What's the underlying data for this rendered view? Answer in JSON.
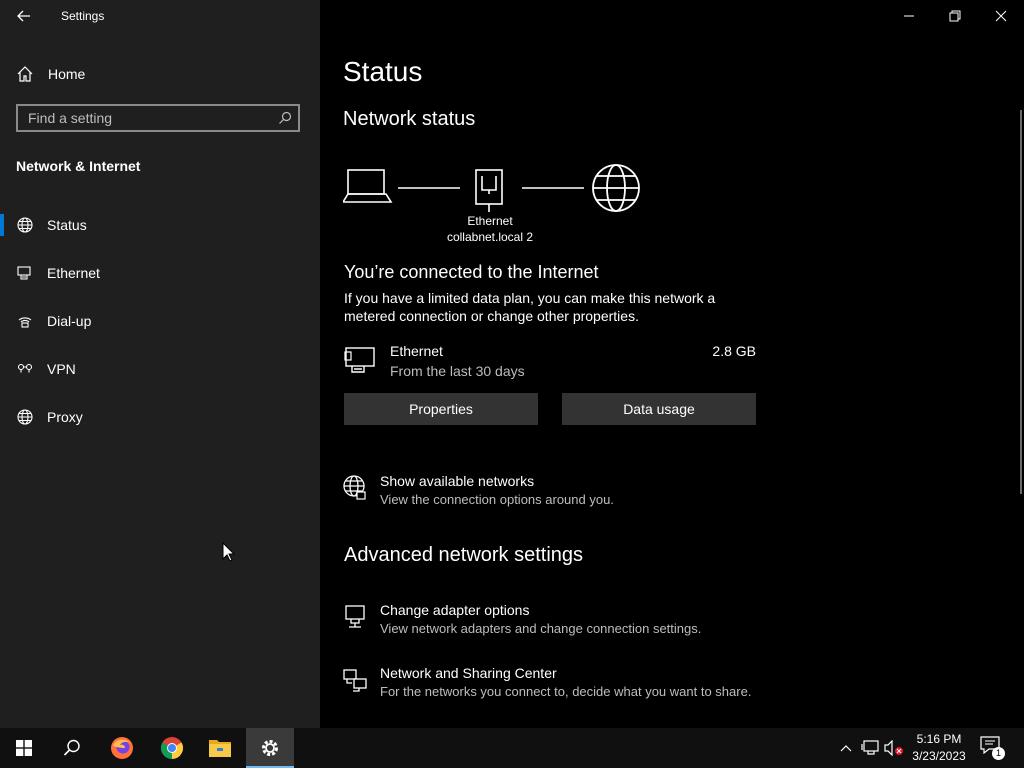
{
  "window": {
    "title": "Settings",
    "controls": {
      "minimize": "minimize",
      "restore": "restore",
      "close": "close"
    }
  },
  "sidebar": {
    "home_label": "Home",
    "search": {
      "placeholder": "Find a setting",
      "value": ""
    },
    "section_title": "Network & Internet",
    "items": [
      {
        "label": "Status",
        "icon": "globe-icon",
        "active": true
      },
      {
        "label": "Ethernet",
        "icon": "ethernet-icon",
        "active": false
      },
      {
        "label": "Dial-up",
        "icon": "dialup-icon",
        "active": false
      },
      {
        "label": "VPN",
        "icon": "vpn-icon",
        "active": false
      },
      {
        "label": "Proxy",
        "icon": "globe-icon",
        "active": false
      }
    ]
  },
  "main": {
    "page_title": "Status",
    "network_status_title": "Network status",
    "diagram": {
      "adapter_name": "Ethernet",
      "network_name": "collabnet.local 2"
    },
    "connected_title": "You’re connected to the Internet",
    "connected_desc": "If you have a limited data plan, you can make this network a metered connection or change other properties.",
    "connection": {
      "name": "Ethernet",
      "subtitle": "From the last 30 days",
      "usage": "2.8 GB"
    },
    "buttons": {
      "properties": "Properties",
      "data_usage": "Data usage"
    },
    "show_networks": {
      "title": "Show available networks",
      "subtitle": "View the connection options around you."
    },
    "advanced_title": "Advanced network settings",
    "advanced_links": [
      {
        "title": "Change adapter options",
        "subtitle": "View network adapters and change connection settings."
      },
      {
        "title": "Network and Sharing Center",
        "subtitle": "For the networks you connect to, decide what you want to share."
      }
    ]
  },
  "taskbar": {
    "apps": [
      "start-icon",
      "search-icon",
      "firefox-icon",
      "chrome-icon",
      "file-explorer-icon",
      "settings-icon"
    ],
    "clock": {
      "time": "5:16 PM",
      "date": "3/23/2023"
    },
    "notifications_count": "1"
  },
  "colors": {
    "accent": "#0078d4",
    "sidebar_bg": "#1f1f1f",
    "main_bg": "#000000",
    "button_bg": "#333333"
  }
}
